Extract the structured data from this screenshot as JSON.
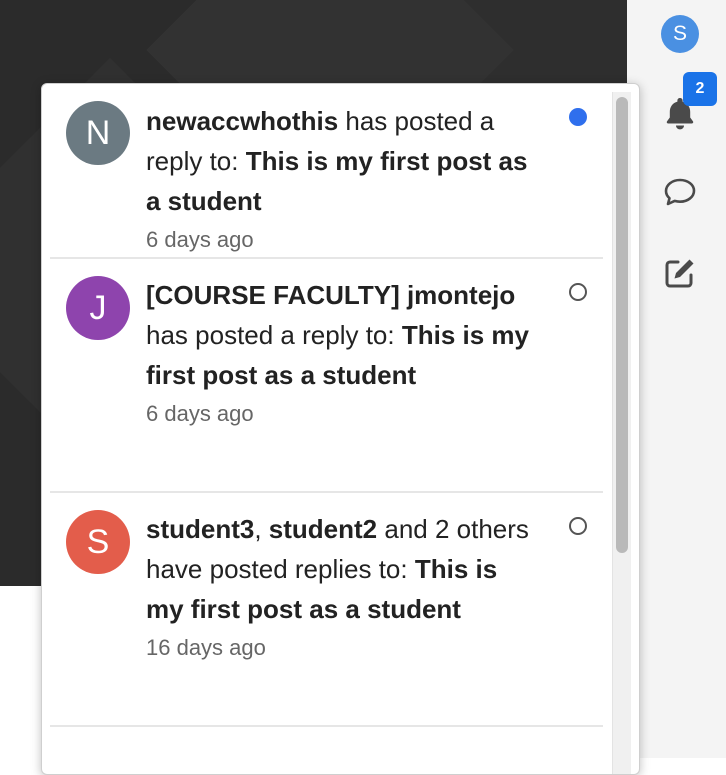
{
  "header": {
    "user_avatar_initial": "S",
    "notification_count": "2",
    "colors": {
      "avatar": "#4a90e2",
      "badge": "#1a73e8",
      "rail_bg": "#f4f4f4",
      "hero_bg": "#2b2b2b"
    }
  },
  "notifications": {
    "items": [
      {
        "avatar_initial": "N",
        "avatar_color": "#6b7a82",
        "actor": "newaccwhothis",
        "mid_text": " has posted a reply to: ",
        "post_title": "This is my first post as a student",
        "time": "6 days ago",
        "unread": true
      },
      {
        "avatar_initial": "J",
        "avatar_color": "#8e44ad",
        "actor_prefix": "[COURSE FACULTY] jmontejo",
        "mid_text": " has posted a reply to: ",
        "post_title": "This is my first post as a student",
        "time": "6 days ago",
        "unread": false
      },
      {
        "avatar_initial": "S",
        "avatar_color": "#e35d4b",
        "actor": "student3",
        "separator": ", ",
        "actor2": "student2",
        "mid_text": " and 2 others have posted replies to: ",
        "post_title": "This is my first post as a student",
        "time": "16 days ago",
        "unread": false
      }
    ]
  }
}
